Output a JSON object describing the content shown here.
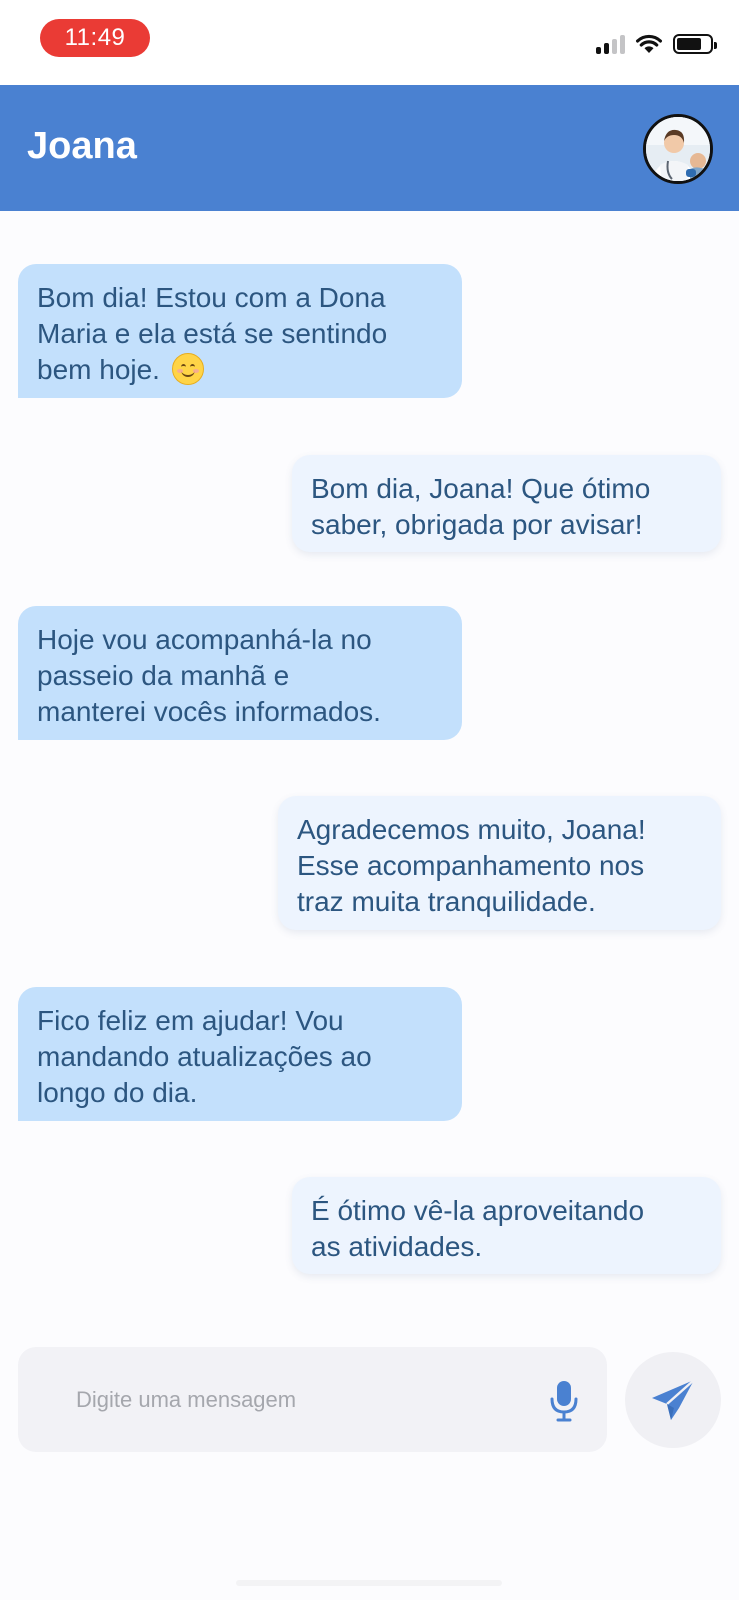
{
  "status_bar": {
    "time": "11:49",
    "icons": [
      "cellular-signal-icon",
      "wifi-icon",
      "battery-icon"
    ]
  },
  "header": {
    "title": "Joana",
    "avatar_icon": "caregiver-avatar",
    "color": "#4a81d1"
  },
  "messages": [
    {
      "direction": "incoming",
      "lines": [
        "Bom dia! Estou com a Dona",
        "Maria e ela está se sentindo",
        "bem hoje."
      ],
      "emoji": "smiling-face-icon"
    },
    {
      "direction": "outgoing",
      "lines": [
        "Bom dia, Joana! Que ótimo",
        "saber, obrigada por avisar!"
      ]
    },
    {
      "direction": "incoming",
      "lines": [
        "Hoje vou acompanhá-la no",
        "passeio da manhã e",
        "manterei vocês informados."
      ]
    },
    {
      "direction": "outgoing",
      "lines": [
        "Agradecemos muito, Joana!",
        "Esse acompanhamento nos",
        "traz muita tranquilidade."
      ]
    },
    {
      "direction": "incoming",
      "lines": [
        "Fico feliz em ajudar! Vou",
        "mandando atualizações ao",
        "longo do dia."
      ]
    },
    {
      "direction": "outgoing",
      "lines": [
        "É ótimo vê-la aproveitando",
        "as atividades."
      ]
    }
  ],
  "composer": {
    "placeholder": "Digite uma mensagem",
    "mic_icon": "microphone-icon",
    "send_icon": "send-icon",
    "accent": "#4a81d1"
  },
  "colors": {
    "incoming_bubble": "#c3e0fc",
    "outgoing_bubble": "#edf4fe",
    "message_text": "#2c5680",
    "time_pill": "#ea3b35"
  }
}
